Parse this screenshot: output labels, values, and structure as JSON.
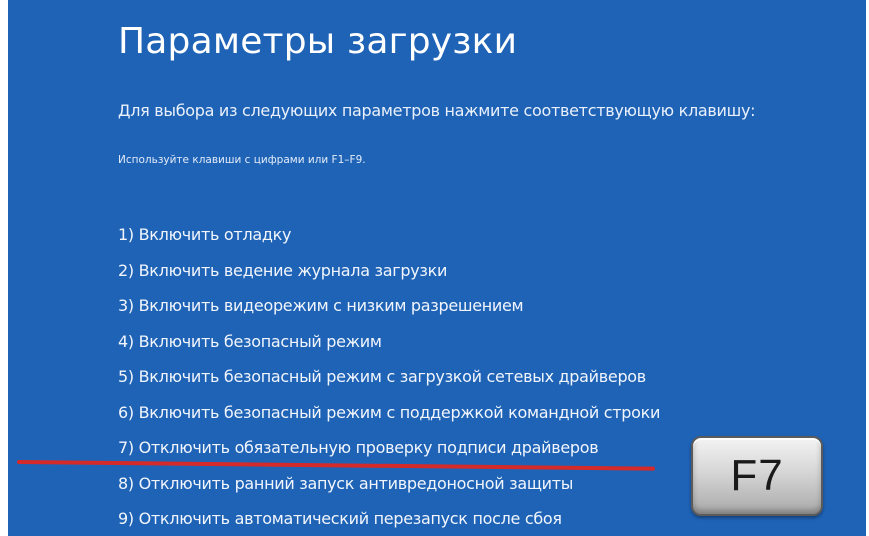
{
  "screen": {
    "title": "Параметры загрузки",
    "subtitle": "Для выбора из следующих параметров нажмите соответствующую клавишу:",
    "hint": "Используйте клавиши с цифрами или F1–F9.",
    "options": [
      {
        "label": "1) Включить отладку"
      },
      {
        "label": "2) Включить ведение журнала загрузки"
      },
      {
        "label": "3) Включить видеорежим с низким разрешением"
      },
      {
        "label": "4) Включить безопасный режим"
      },
      {
        "label": "5) Включить безопасный режим с загрузкой сетевых драйверов"
      },
      {
        "label": "6) Включить безопасный режим с поддержкой командной строки"
      },
      {
        "label": "7) Отключить обязательную проверку подписи драйверов"
      },
      {
        "label": "8) Отключить ранний запуск антивредоносной защиты"
      },
      {
        "label": "9) Отключить автоматический перезапуск после сбоя"
      }
    ],
    "highlighted_option_index": 7
  },
  "key_overlay": {
    "label": "F7"
  },
  "colors": {
    "background": "#1f63b7",
    "text": "#ffffff",
    "underline": "#d42a2a",
    "key_face": "#d6d6d6"
  }
}
